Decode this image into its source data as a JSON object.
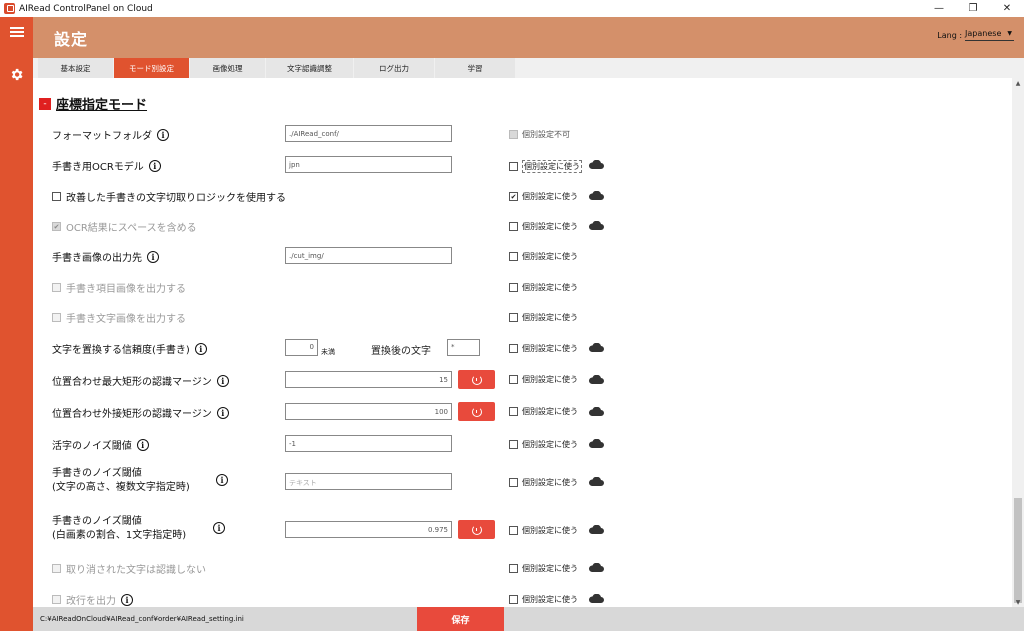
{
  "window": {
    "title": "AIRead ControlPanel on Cloud",
    "controls": {
      "minimize": "—",
      "restore": "❐",
      "close": "✕"
    }
  },
  "header": {
    "title": "設定",
    "lang_label": "Lang :",
    "lang_value": "Japanese"
  },
  "tabs": [
    {
      "label": "基本設定",
      "active": false
    },
    {
      "label": "モード別設定",
      "active": true
    },
    {
      "label": "画像処理",
      "active": false
    },
    {
      "label": "文字認識調整",
      "active": false
    },
    {
      "label": "ログ出力",
      "active": false
    },
    {
      "label": "学習",
      "active": false
    }
  ],
  "section": {
    "toggle": "-",
    "title": "座標指定モード"
  },
  "rows": {
    "format_folder": {
      "label": "フォーマットフォルダ",
      "value": "./AIRead_conf/",
      "indiv": "個別設定不可"
    },
    "ocr_model": {
      "label": "手書き用OCRモデル",
      "value": "jpn",
      "indiv": "個別設定に使う"
    },
    "improved_logic": {
      "label": "改善した手書きの文字切取りロジックを使用する",
      "indiv": "個別設定に使う",
      "indiv_checked": true
    },
    "ocr_space": {
      "label": "OCR結果にスペースを含める",
      "indiv": "個別設定に使う"
    },
    "handwriting_output": {
      "label": "手書き画像の出力先",
      "value": "./cut_img/",
      "indiv": "個別設定に使う"
    },
    "item_image": {
      "label": "手書き項目画像を出力する",
      "indiv": "個別設定に使う"
    },
    "char_image": {
      "label": "手書き文字画像を出力する",
      "indiv": "個別設定に使う"
    },
    "replace_conf": {
      "label": "文字を置換する信頼度(手書き)",
      "value": "0",
      "unit": "未満",
      "after_label": "置換後の文字",
      "after_value": "*",
      "indiv": "個別設定に使う"
    },
    "max_rect_margin": {
      "label": "位置合わせ最大矩形の認識マージン",
      "value": "15",
      "indiv": "個別設定に使う"
    },
    "outer_rect_margin": {
      "label": "位置合わせ外接矩形の認識マージン",
      "value": "100",
      "indiv": "個別設定に使う"
    },
    "print_noise": {
      "label": "活字のノイズ閾値",
      "value": "-1",
      "indiv": "個別設定に使う"
    },
    "hand_noise_height": {
      "label1": "手書きのノイズ閾値",
      "label2": "(文字の高さ、複数文字指定時)",
      "placeholder": "テキスト",
      "indiv": "個別設定に使う"
    },
    "hand_noise_white": {
      "label1": "手書きのノイズ閾値",
      "label2": "(白画素の割合、1文字指定時)",
      "value": "0.975",
      "indiv": "個別設定に使う"
    },
    "ignore_cancelled": {
      "label": "取り消された文字は認識しない",
      "indiv": "個別設定に使う"
    },
    "newline_output": {
      "label": "改行を出力",
      "indiv": "個別設定に使う"
    }
  },
  "footer": {
    "ini_path": "C:¥AIReadOnCloud¥AIRead_conf¥order¥AIRead_setting.ini",
    "save_label": "保存"
  },
  "colors": {
    "rail": "#e0532f",
    "header": "#d4906a",
    "accent": "#e84a3c"
  }
}
